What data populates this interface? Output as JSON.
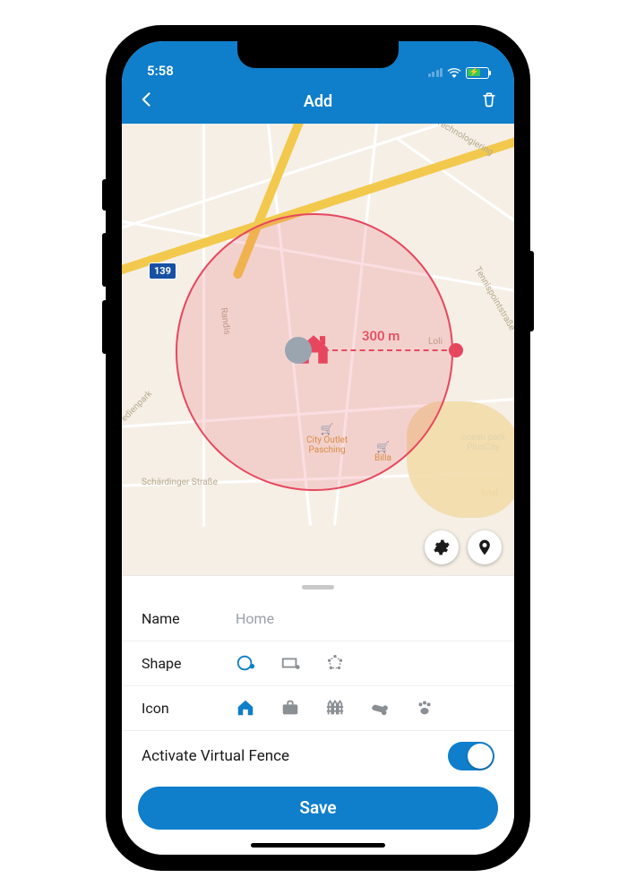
{
  "status": {
    "time": "5:58"
  },
  "nav": {
    "title": "Add"
  },
  "map": {
    "route_badge": "139",
    "radius_label": "300 m",
    "labels": {
      "technologiering": "Technologiering",
      "randis": "Randis",
      "tennispoint": "Tennispointstraße",
      "loli": "Loli",
      "medienpark": "edienpark",
      "schardinger": "Schärdinger Straße",
      "city_outlet": "City Outlet\nPasching",
      "billa": "Billa",
      "ocean_park": "ocean park\nPlusCity",
      "intel": "Intel"
    }
  },
  "form": {
    "name_label": "Name",
    "name_placeholder": "Home",
    "name_value": "",
    "shape_label": "Shape",
    "icon_label": "Icon",
    "activate_label": "Activate Virtual Fence",
    "save_label": "Save"
  }
}
